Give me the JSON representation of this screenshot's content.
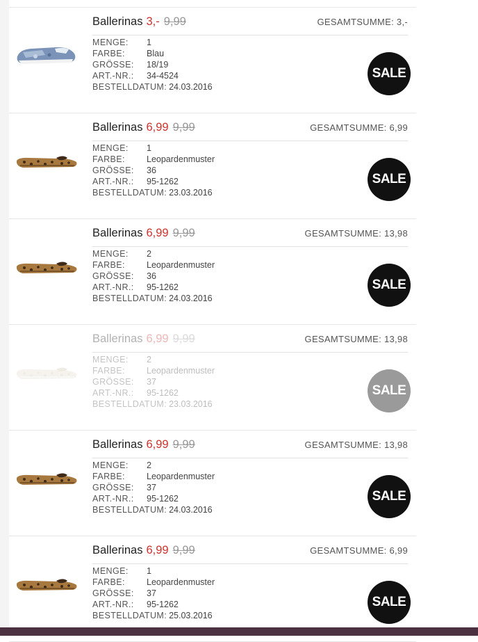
{
  "labels": {
    "quantity": "MENGE:",
    "color": "FARBE:",
    "size": "GRÖSSE:",
    "article": "ART.-NR.:",
    "order_date": "BESTELLDATUM:",
    "total_prefix": "GESAMTSUMME:",
    "sale": "SALE"
  },
  "orders": [
    {
      "name": "Ballerinas",
      "price_now": "3,-",
      "price_old": "9,99",
      "total": "GESAMTSUMME: 3,-",
      "quantity": "1",
      "color": "Blau",
      "size": "18/19",
      "article": "34-4524",
      "date": "24.03.2016",
      "image": "denim-ballerina"
    },
    {
      "name": "Ballerinas",
      "price_now": "6,99",
      "price_old": "9,99",
      "total": "GESAMTSUMME: 6,99",
      "quantity": "1",
      "color": "Leopardenmuster",
      "size": "36",
      "article": "95-1262",
      "date": "23.03.2016",
      "image": "leopard-ballerina"
    },
    {
      "name": "Ballerinas",
      "price_now": "6,99",
      "price_old": "9,99",
      "total": "GESAMTSUMME: 13,98",
      "quantity": "2",
      "color": "Leopardenmuster",
      "size": "36",
      "article": "95-1262",
      "date": "24.03.2016",
      "image": "leopard-ballerina"
    },
    {
      "name": "Ballerinas",
      "price_now": "6,99",
      "price_old": "9,99",
      "total": "GESAMTSUMME: 13,98",
      "quantity": "2",
      "color": "Leopardenmuster",
      "size": "37",
      "article": "95-1262",
      "date": "23.03.2016",
      "image": "leopard-ballerina-faded"
    },
    {
      "name": "Ballerinas",
      "price_now": "6,99",
      "price_old": "9,99",
      "total": "GESAMTSUMME: 13,98",
      "quantity": "2",
      "color": "Leopardenmuster",
      "size": "37",
      "article": "95-1262",
      "date": "24.03.2016",
      "image": "leopard-ballerina"
    },
    {
      "name": "Ballerinas",
      "price_now": "6,99",
      "price_old": "9,99",
      "total": "GESAMTSUMME: 6,99",
      "quantity": "1",
      "color": "Leopardenmuster",
      "size": "37",
      "article": "95-1262",
      "date": "25.03.2016",
      "image": "leopard-ballerina"
    }
  ]
}
